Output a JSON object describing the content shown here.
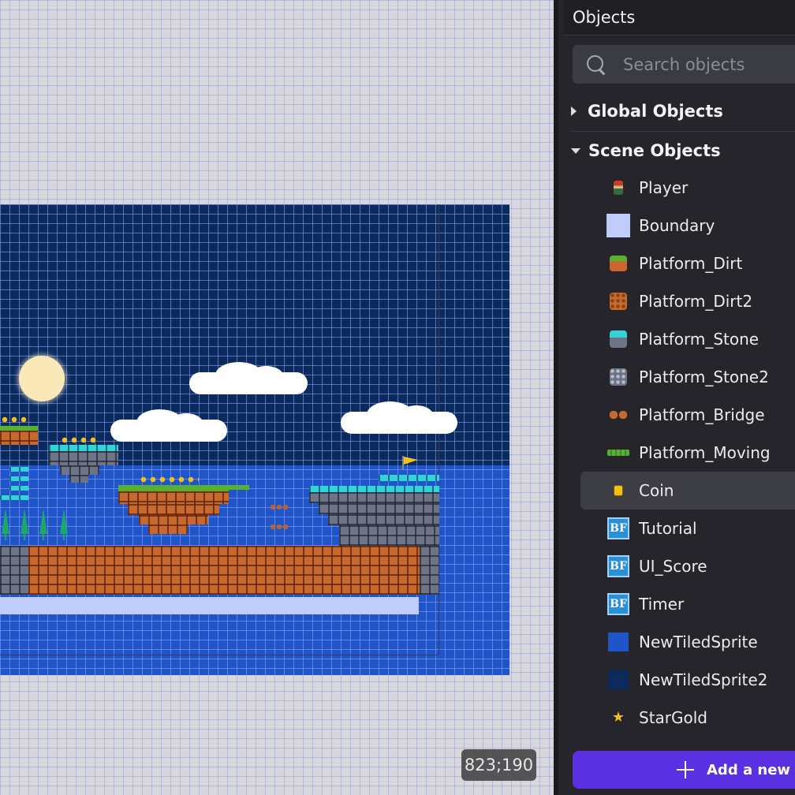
{
  "editor": {
    "cursor_coordinates": "823;190"
  },
  "panel": {
    "title": "Objects",
    "search": {
      "placeholder": "Search objects",
      "value": ""
    },
    "groups": {
      "global": {
        "label": "Global Objects",
        "expanded": false
      },
      "scene": {
        "label": "Scene Objects",
        "expanded": true
      }
    },
    "objects": [
      {
        "label": "Player",
        "icon": "player-sprite-icon"
      },
      {
        "label": "Boundary",
        "icon": "boundary-sprite-icon"
      },
      {
        "label": "Platform_Dirt",
        "icon": "platform-dirt-icon"
      },
      {
        "label": "Platform_Dirt2",
        "icon": "platform-dirt2-icon"
      },
      {
        "label": "Platform_Stone",
        "icon": "platform-stone-icon"
      },
      {
        "label": "Platform_Stone2",
        "icon": "platform-stone2-icon"
      },
      {
        "label": "Platform_Bridge",
        "icon": "platform-bridge-icon"
      },
      {
        "label": "Platform_Moving",
        "icon": "platform-moving-icon"
      },
      {
        "label": "Coin",
        "icon": "coin-icon",
        "selected": true
      },
      {
        "label": "Tutorial",
        "icon": "bitmap-text-icon",
        "icon_text": "BF"
      },
      {
        "label": "UI_Score",
        "icon": "bitmap-text-icon",
        "icon_text": "BF"
      },
      {
        "label": "Timer",
        "icon": "bitmap-text-icon",
        "icon_text": "BF"
      },
      {
        "label": "NewTiledSprite",
        "icon": "tiled-sprite-icon"
      },
      {
        "label": "NewTiledSprite2",
        "icon": "tiled-sprite2-icon"
      },
      {
        "label": "StarGold",
        "icon": "star-icon"
      }
    ],
    "add_button_label": "Add a new ob"
  },
  "colors": {
    "accent": "#5a31e0",
    "panel_bg": "#25252b",
    "sky": "#0b2a5e",
    "water": "#1f55c8"
  }
}
